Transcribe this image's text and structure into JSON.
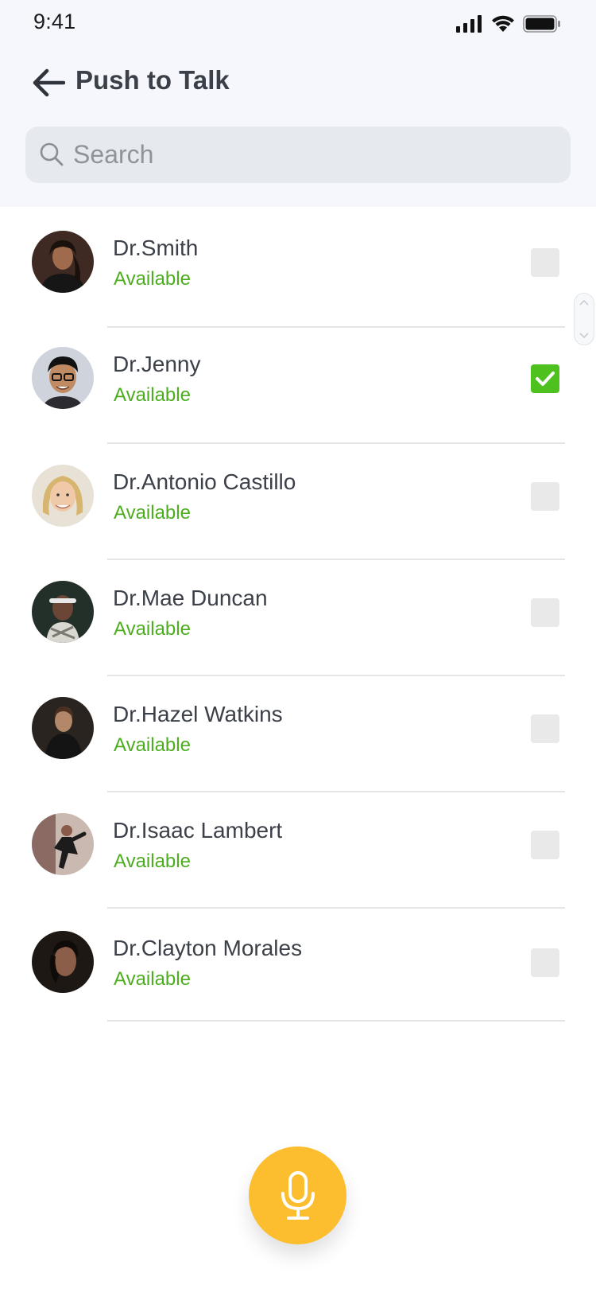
{
  "status_bar": {
    "time": "9:41"
  },
  "header": {
    "title": "Push to Talk"
  },
  "search": {
    "placeholder": "Search",
    "value": ""
  },
  "contacts": [
    {
      "name": "Dr.Smith",
      "status": "Available",
      "checked": false,
      "avatar": "avatar-woman-dark-hair"
    },
    {
      "name": "Dr.Jenny",
      "status": "Available",
      "checked": true,
      "avatar": "avatar-man-glasses"
    },
    {
      "name": "Dr.Antonio Castillo",
      "status": "Available",
      "checked": false,
      "avatar": "avatar-woman-blonde"
    },
    {
      "name": "Dr.Mae Duncan",
      "status": "Available",
      "checked": false,
      "avatar": "avatar-woman-headband"
    },
    {
      "name": "Dr.Hazel Watkins",
      "status": "Available",
      "checked": false,
      "avatar": "avatar-man-dark"
    },
    {
      "name": "Dr.Isaac Lambert",
      "status": "Available",
      "checked": false,
      "avatar": "avatar-person-dancing"
    },
    {
      "name": "Dr.Clayton Morales",
      "status": "Available",
      "checked": false,
      "avatar": "avatar-woman-portrait"
    }
  ],
  "icons": {
    "back": "back-arrow-icon",
    "search": "search-icon",
    "mic": "microphone-icon",
    "check": "checkmark-icon"
  },
  "colors": {
    "available": "#4cae1f",
    "checked": "#4ec11f",
    "mic_button": "#fcbd2e",
    "header_bg": "#f5f7fc"
  }
}
